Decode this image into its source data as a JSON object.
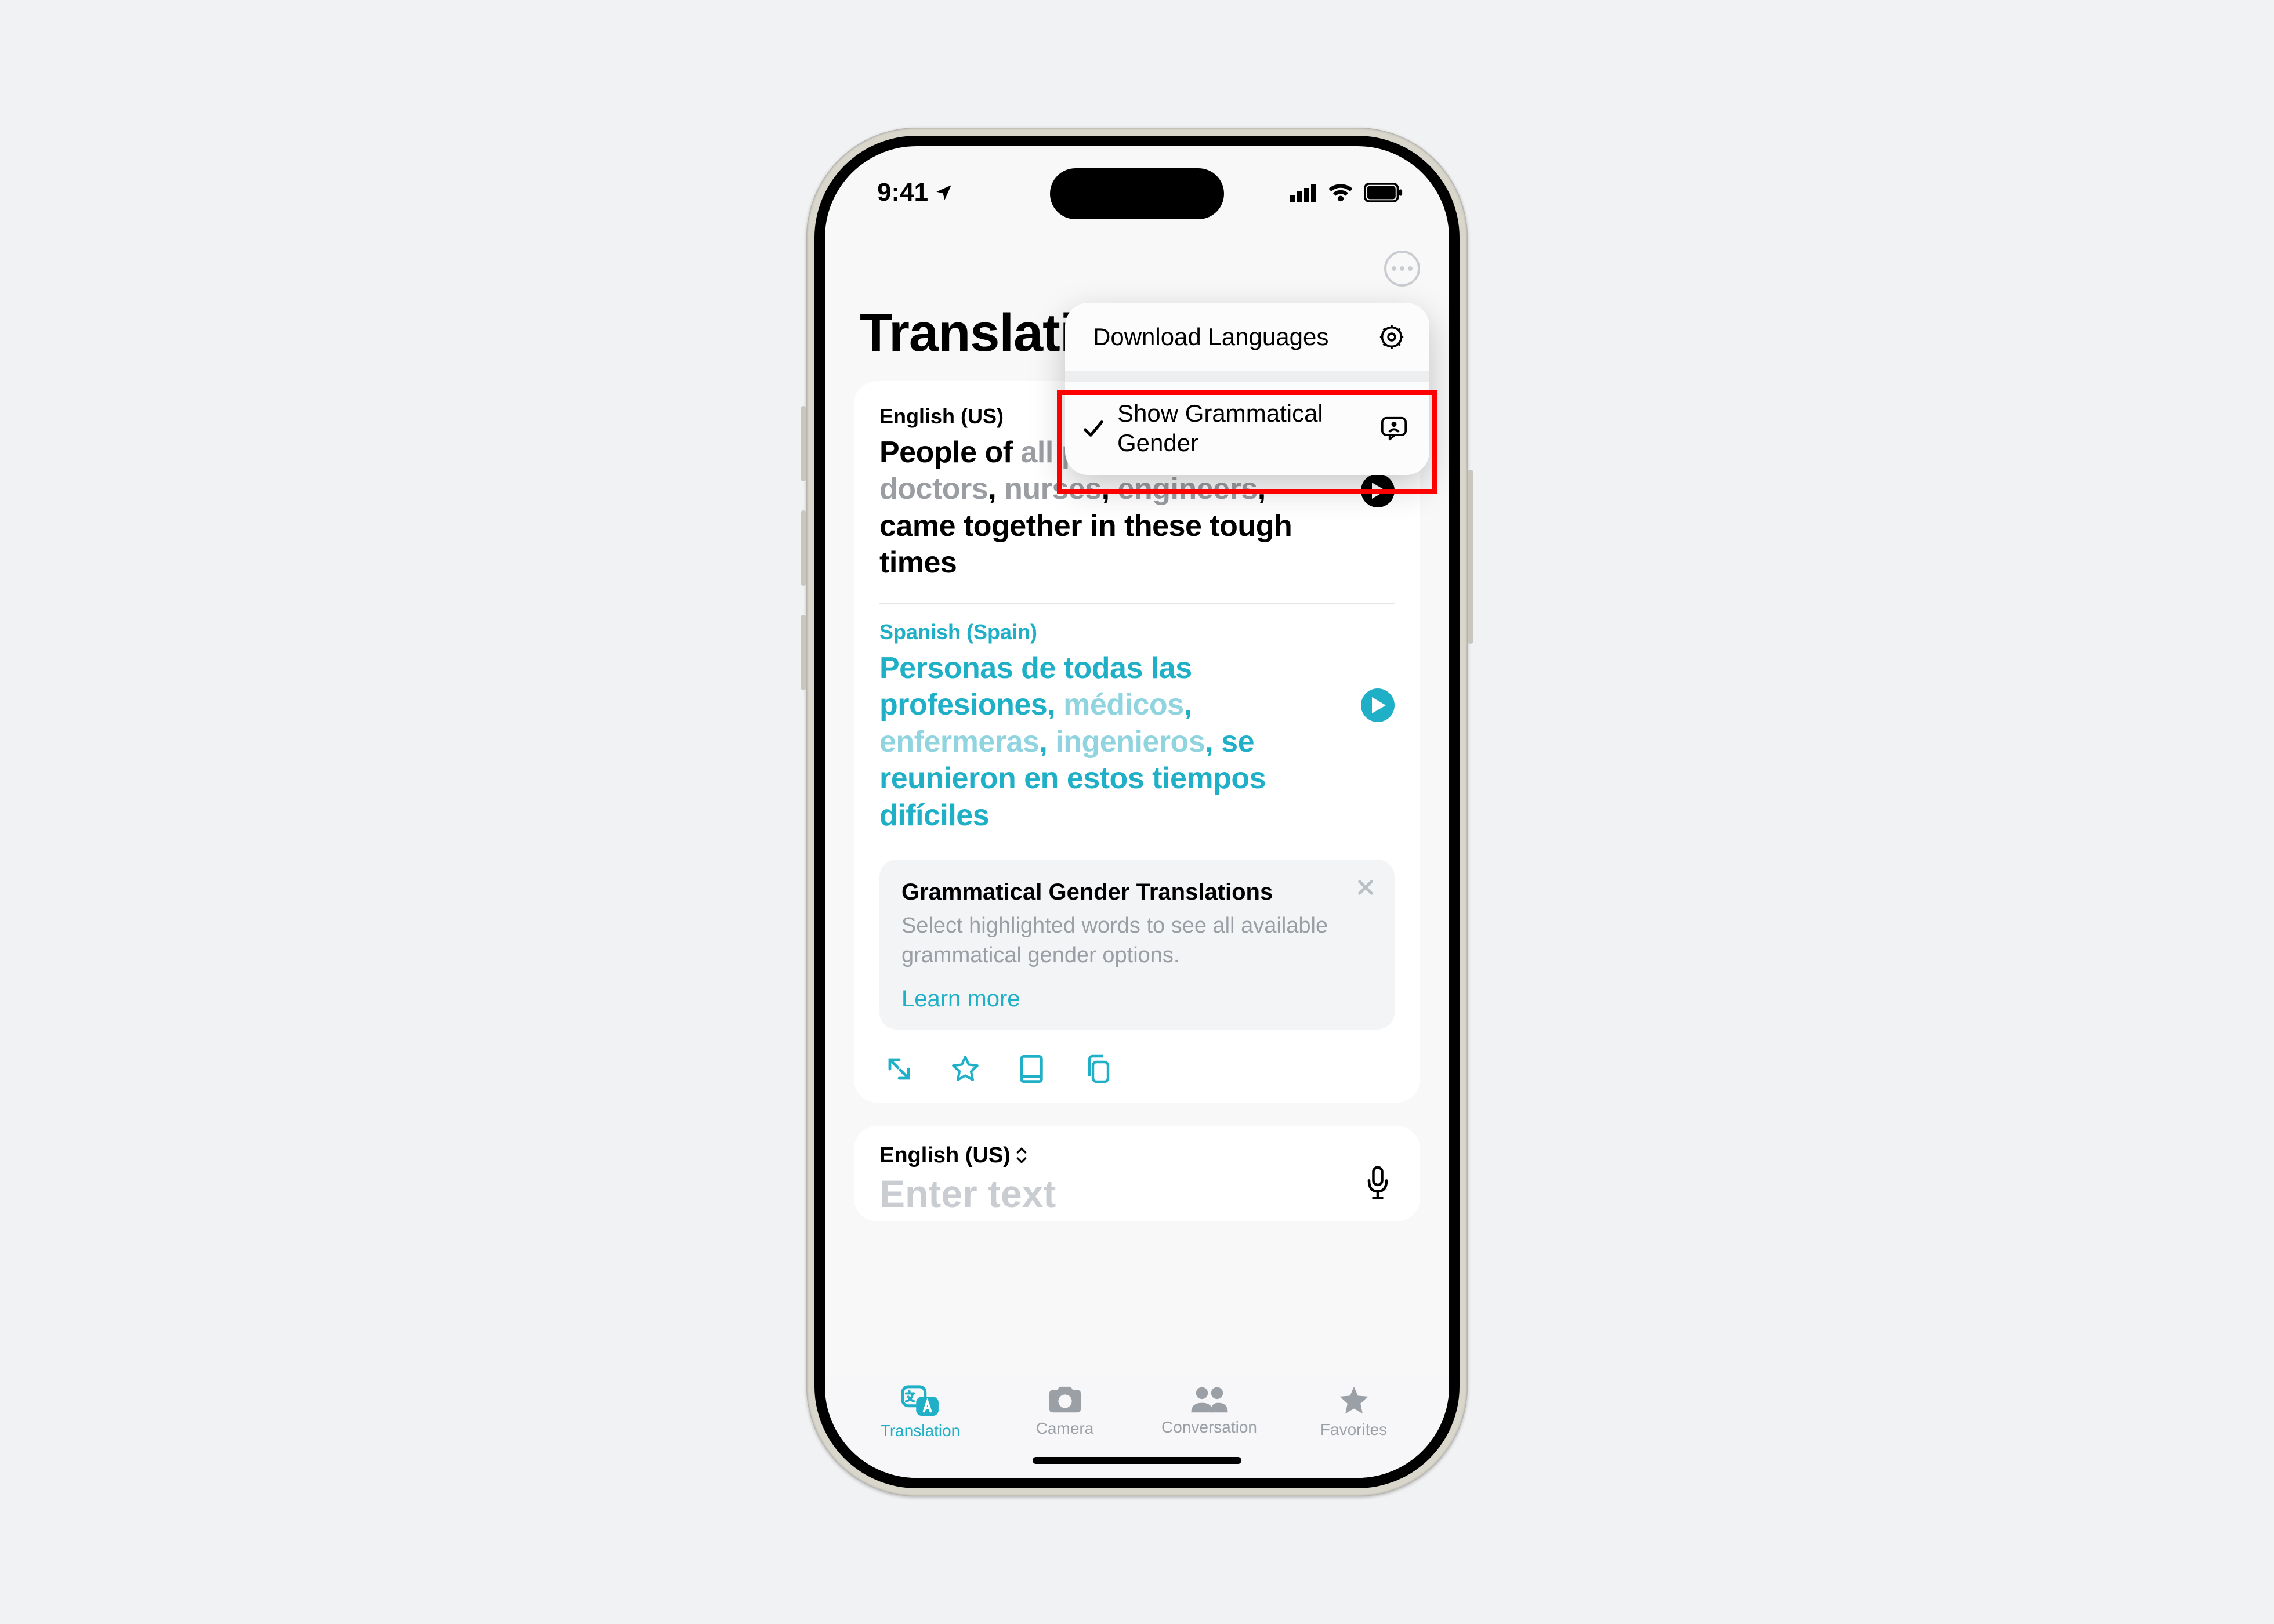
{
  "status": {
    "time": "9:41"
  },
  "page": {
    "title": "Translation"
  },
  "menu": {
    "download": "Download Languages",
    "grammatical": "Show Grammatical Gender"
  },
  "source": {
    "lang": "English (US)",
    "t1": "People of ",
    "g0": "all professions",
    "t2": ", ",
    "g1": "doctors",
    "t3": ", ",
    "g2": "nurses",
    "t4": ", ",
    "g3": "engineers",
    "t5": ", came together in these tough times"
  },
  "target": {
    "lang": "Spanish (Spain)",
    "t1": "Personas de todas las profesiones, ",
    "g1": "médicos",
    "t2": ", ",
    "g2": "enfermeras",
    "t3": ", ",
    "g3": "ingenieros",
    "t4": ", se reunieron en estos tiempos difíciles"
  },
  "info": {
    "title": "Grammatical Gender Translations",
    "body": "Select highlighted words to see all available grammatical gender options.",
    "link": "Learn more"
  },
  "input": {
    "lang": "English (US)",
    "placeholder": "Enter text"
  },
  "tabs": {
    "translation": "Translation",
    "camera": "Camera",
    "conversation": "Conversation",
    "favorites": "Favorites"
  }
}
